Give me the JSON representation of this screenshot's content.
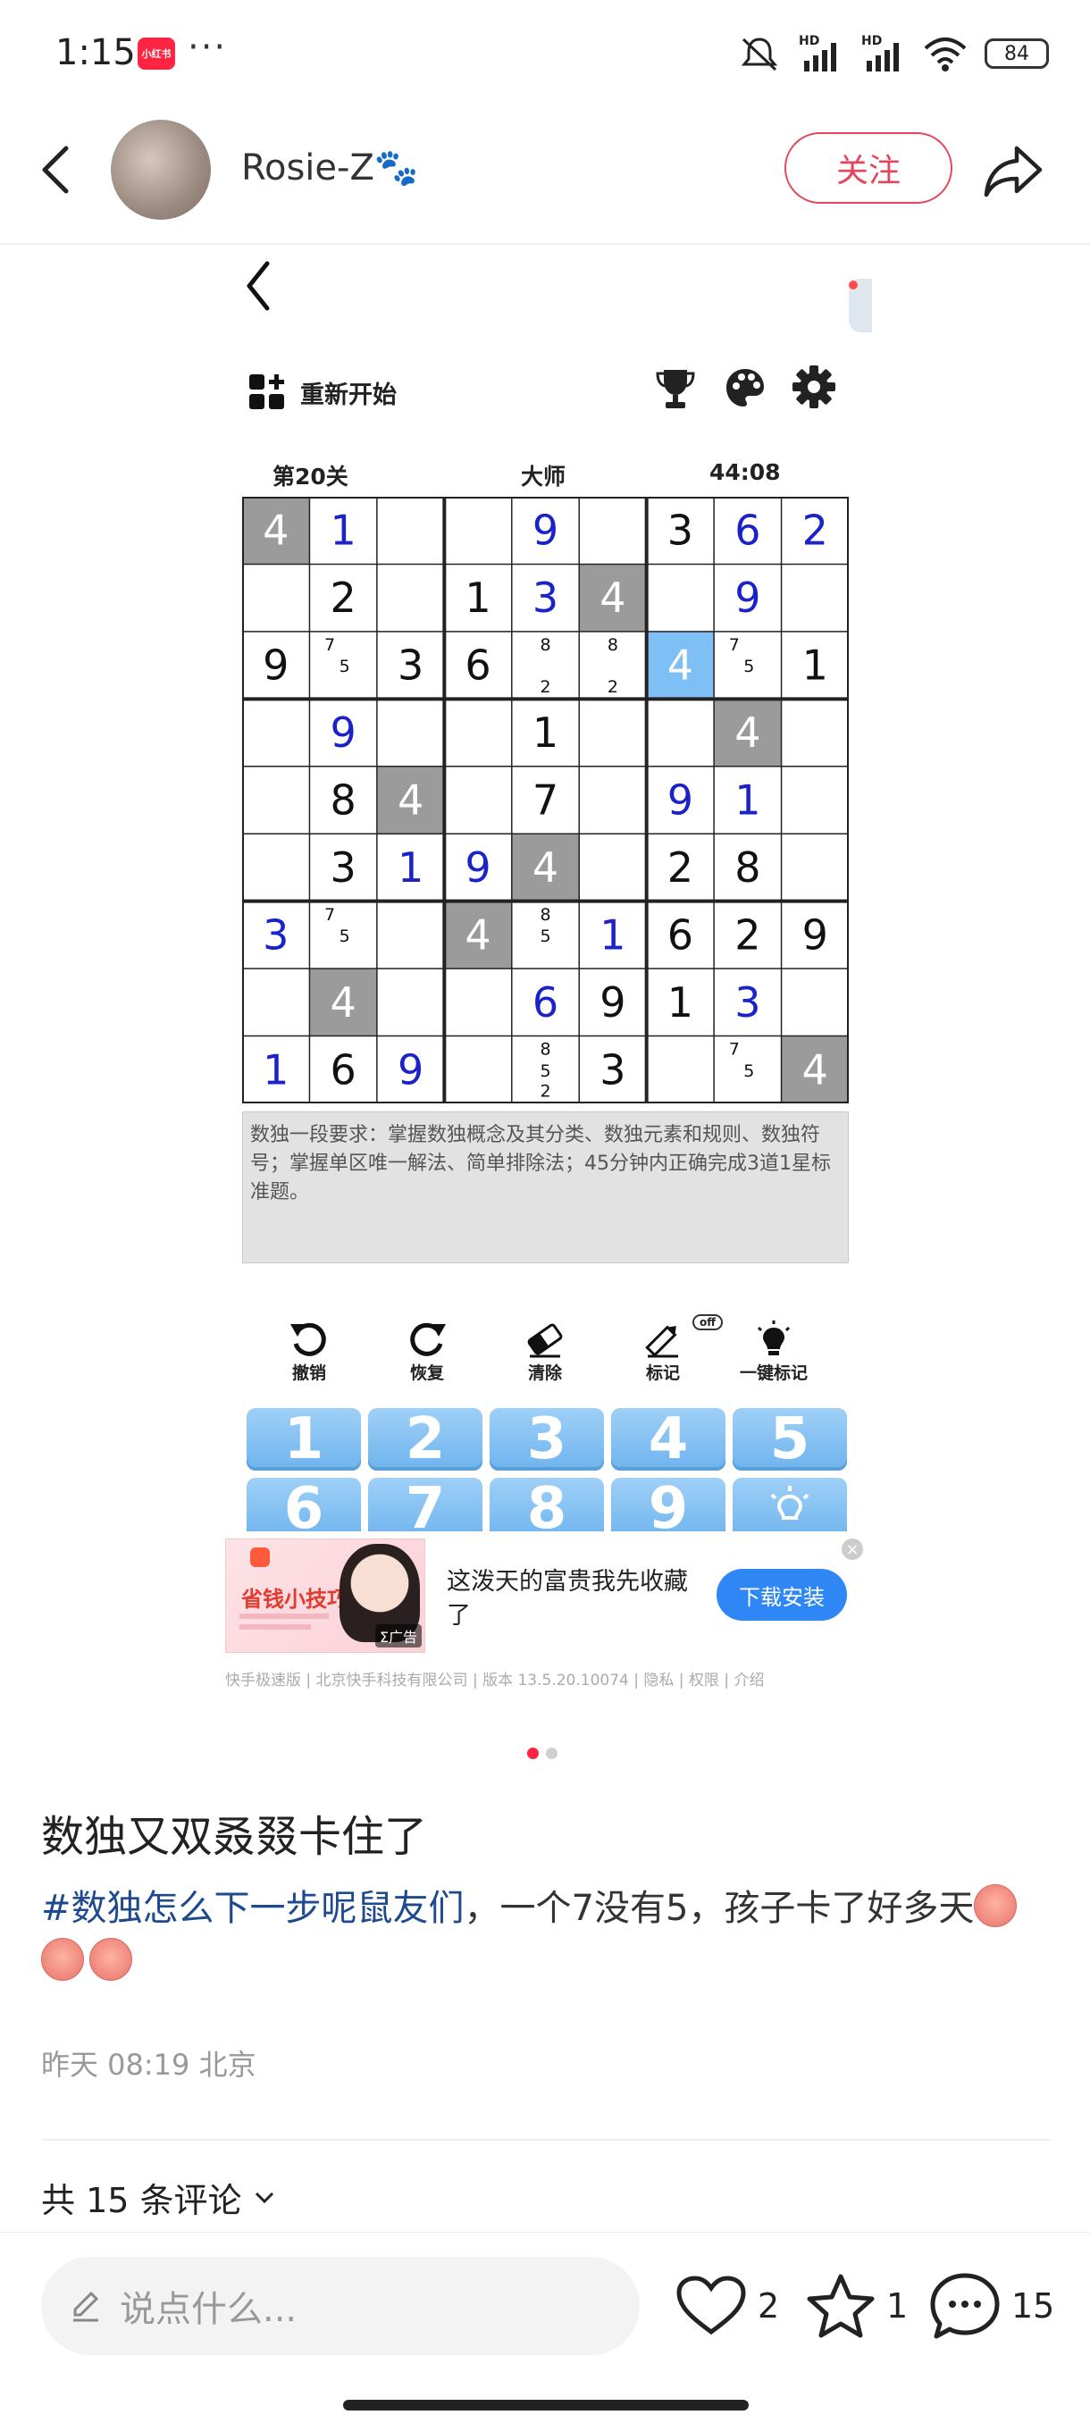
{
  "status_bar": {
    "time": "1:15",
    "app_badge": "小红书",
    "more": "···",
    "hd1": "HD",
    "hd2": "HD",
    "battery": "84"
  },
  "header": {
    "author": "Rosie-Z🐾",
    "follow_label": "关注"
  },
  "game": {
    "restart_label": "重新开始",
    "level": "第20关",
    "difficulty": "大师",
    "timer": "44:08",
    "grid": [
      [
        "4",
        "1",
        "",
        "",
        "9",
        "",
        "3",
        "6",
        "2"
      ],
      [
        "",
        "2",
        "",
        "1",
        "3",
        "4",
        "",
        "9",
        ""
      ],
      [
        "9",
        "n:7,5",
        "3",
        "6",
        "n:8,2",
        "n:8,2",
        "4",
        "n:7,5",
        "1"
      ],
      [
        "",
        "9",
        "",
        "",
        "1",
        "",
        "",
        "4",
        ""
      ],
      [
        "",
        "8",
        "4",
        "",
        "7",
        "",
        "9",
        "1",
        ""
      ],
      [
        "",
        "3",
        "1",
        "9",
        "4",
        "",
        "2",
        "8",
        ""
      ],
      [
        "3",
        "n:7,5",
        "",
        "4",
        "n:8,5",
        "1",
        "6",
        "2",
        "9"
      ],
      [
        "",
        "4",
        "",
        "",
        "6",
        "9",
        "1",
        "3",
        ""
      ],
      [
        "1",
        "6",
        "9",
        "",
        "n:8,5,2",
        "3",
        "",
        "n:7,5",
        "4"
      ]
    ],
    "cell_styles": [
      [
        "gray",
        "blue",
        "",
        "",
        "blue",
        "",
        "",
        "blue",
        "blue"
      ],
      [
        "",
        "",
        "",
        "",
        "blue",
        "gray",
        "",
        "blue",
        ""
      ],
      [
        "",
        "",
        "",
        "",
        "",
        "",
        "sel",
        "",
        ""
      ],
      [
        "",
        "blue",
        "",
        "",
        "",
        "",
        "",
        "gray",
        ""
      ],
      [
        "",
        "",
        "gray",
        "",
        "",
        "",
        "blue",
        "blue",
        ""
      ],
      [
        "",
        "",
        "blue",
        "blue",
        "gray",
        "",
        "",
        "",
        ""
      ],
      [
        "blue",
        "",
        "",
        "gray",
        "",
        "blue",
        "",
        "",
        ""
      ],
      [
        "",
        "gray",
        "",
        "",
        "blue",
        "",
        "",
        "blue",
        ""
      ],
      [
        "blue",
        "",
        "blue",
        "",
        "",
        "",
        "",
        "",
        "gray"
      ]
    ],
    "description": "数独一段要求：掌握数独概念及其分类、数独元素和规则、数独符号；掌握单区唯一解法、简单排除法；45分钟内正确完成3道1星标准题。",
    "tools": {
      "undo": "撤销",
      "redo": "恢复",
      "clear": "清除",
      "mark": "标记",
      "auto_mark": "一键标记",
      "mark_state": "off"
    },
    "keypad": [
      "1",
      "2",
      "3",
      "4",
      "5",
      "6",
      "7",
      "8",
      "9"
    ]
  },
  "ad": {
    "thumb_title": "省钱小技巧",
    "tag": "Σ广告",
    "text": "这泼天的富贵我先收藏了",
    "button": "下载安装",
    "close": "×",
    "footer": "快手极速版 | 北京快手科技有限公司 | 版本 13.5.20.10074 | 隐私 | 权限 | 介绍"
  },
  "post": {
    "title": "数独又双叒叕卡住了",
    "hashtag": "#数独怎么下一步呢鼠友们",
    "body": "，一个7没有5，孩子卡了好多天",
    "meta": "昨天 08:19 北京",
    "comments_label": "共 15 条评论"
  },
  "bottom_bar": {
    "input_placeholder": "说点什么...",
    "likes": "2",
    "stars": "1",
    "comments": "15"
  },
  "colors": {
    "accent": "#ff2442",
    "given_digit": "#111111",
    "user_digit": "#1a22c8",
    "highlight_gray": "#9b9b9b",
    "selected_blue": "#7ec0f5",
    "keypad_blue": "#7dbcf2"
  }
}
